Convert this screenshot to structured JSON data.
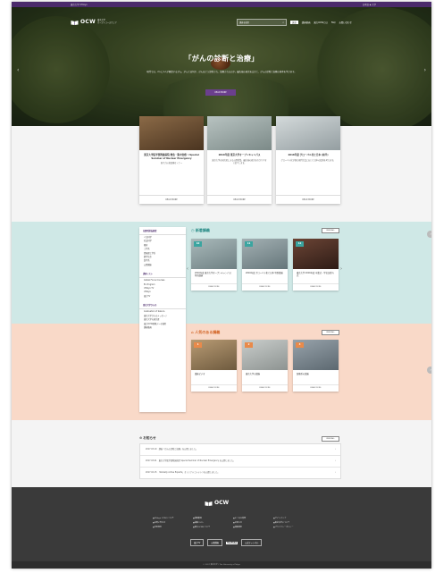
{
  "topbar": {
    "left": "東京大学 UTokyo",
    "right": "日本語 ◆ 大学"
  },
  "logo": {
    "name": "OCW",
    "sub1": "東京大学",
    "sub2": "オープンコースウェア"
  },
  "nav": {
    "search_placeholder": "講義を検索",
    "items": [
      "英語",
      "講義動画",
      "東大OCWとは",
      "FAQ",
      "お問い合わせ"
    ]
  },
  "hero": {
    "title": "「がんの診断と治療」",
    "description": "現代では、2人に1人が罹患するがん。がんとは何か、がんはどう診断され、治療されるのか。最先端の研究を交えて、がんの診断と治療の基本を学びます。",
    "button": "READ MORE"
  },
  "features": [
    {
      "title": "東京大学医学部附属病院 救急・集中治療 〜Special Seminar of Nuclear Emergency",
      "desc": "原子力災害医療セミナー",
      "more": "READ MORE",
      "color": "#7a5a3a"
    },
    {
      "title": "2016年度 東京大学オープンキャンパス",
      "desc": "東京大学の研究者による公開授業。最先端の研究をわかりやすく紹介します。",
      "more": "READ MORE",
      "color": "#9aa7a5"
    },
    {
      "title": "2016年度 グローバル化と日本 (前半)",
      "desc": "グローバル化が進む現代社会において日本の役割を考えます。",
      "more": "READ MORE",
      "color": "#b9c2c4"
    }
  ],
  "sidebar": {
    "groups": [
      {
        "heading": "分野別講義検索",
        "items": [
          "人文科学",
          "社会科学",
          "教育",
          "工学系",
          "情報理工学系",
          "農学生命",
          "医学系",
          "公開講座"
        ]
      },
      {
        "heading": "講座リスト",
        "items": [
          "Global Focus Courses",
          "EL Program",
          "UTokyo TV",
          "UTokyo",
          "東大TV"
        ]
      },
      {
        "heading": "東京大学からの",
        "items": [
          "Graduation of Sakura",
          "東京大学からのメッセージ",
          "東京大学の研究者",
          "東大OCW映像データ検索",
          "講義動画"
        ]
      }
    ]
  },
  "new_courses": {
    "title": "新着講義",
    "view_all": "VIEW ALL",
    "cards": [
      {
        "num": "10",
        "title": "2016年度 東京大学オープンキャンパス 特別講義",
        "more": "READ MORE",
        "color": "#8a9fa0"
      },
      {
        "num": "11",
        "title": "2016年度 グローバル化と日本 特別講義",
        "more": "READ MORE",
        "color": "#7e8f92"
      },
      {
        "num": "12",
        "title": "東京大学 2016年度 卒業式・学位記授与式",
        "more": "READ MORE",
        "color": "#5a3a2c"
      }
    ]
  },
  "popular_courses": {
    "title": "人気のある講義",
    "view_all": "VIEW ALL",
    "cards": [
      {
        "num": "1",
        "title": "講義ビデオ",
        "more": "READ MORE",
        "color": "#a58c6a"
      },
      {
        "num": "2",
        "title": "東京大学の講義",
        "more": "READ MORE",
        "color": "#b4b8b6"
      },
      {
        "num": "3",
        "title": "医療系の講義",
        "more": "READ MORE",
        "color": "#7a8690"
      }
    ]
  },
  "news": {
    "title": "お知らせ",
    "view_all": "VIEW ALL",
    "items": [
      "2017.03.10　講義「がんの診断と治療」を公開しました。",
      "2017.03.01　東京大学医学部附属病院 Special Seminar of Nuclear Emergency を公開しました。",
      "2017.02.15　「Globally Active Experts」オリジナルコンテンツを公開しました。"
    ]
  },
  "footer": {
    "logo": "OCW",
    "links": [
      "UTokyo OCW について",
      "講義動画",
      "よくある質問",
      "サイトマップ",
      "お問い合わせ",
      "講義リスト",
      "お知らせ",
      "東京大学について",
      "利用規約",
      "東大OCWについて",
      "講義検索",
      "プライバシーポリシー"
    ],
    "btn1": "東大TV",
    "btn2": "公開講座",
    "youtube": "YouTube",
    "btn3": "公式チャンネル",
    "copyright": "© 2017 東京大学 / The University of Tokyo"
  },
  "colors": {
    "purple": "#4b2a6b",
    "teal_band": "#cfe8e6",
    "peach_band": "#f9d9c8",
    "teal_badge": "#3aa5a0",
    "orange_badge": "#e98a4a"
  }
}
